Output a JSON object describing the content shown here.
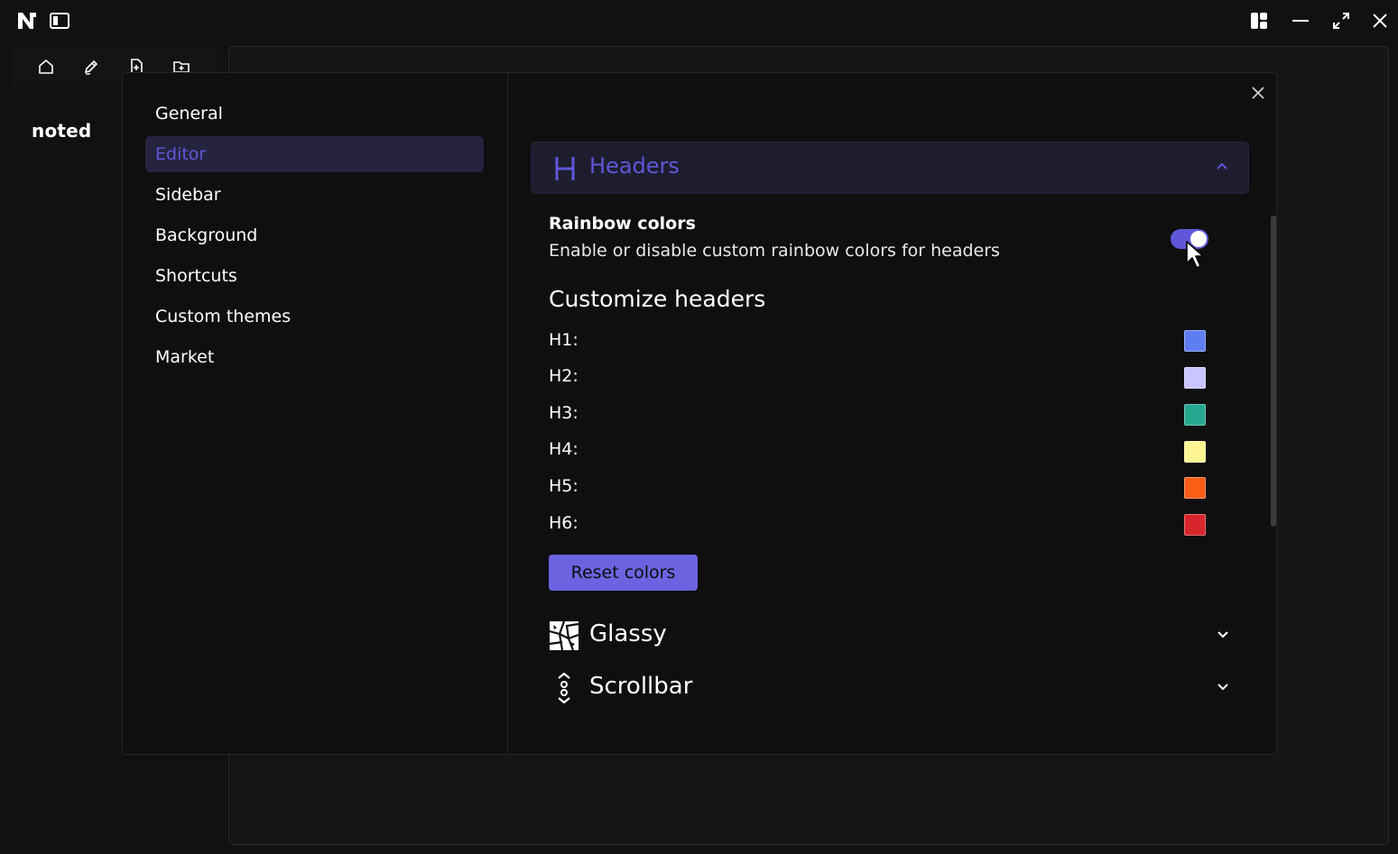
{
  "titlebar": {
    "logo_icon": "app-logo-icon",
    "sidebar_toggle_icon": "sidebar-toggle-icon",
    "window_controls": [
      "layout-icon",
      "minimize-icon",
      "maximize-icon",
      "close-icon"
    ]
  },
  "toolbar": {
    "icons": [
      "home-icon",
      "edit-pen-icon",
      "new-file-icon",
      "new-folder-icon"
    ]
  },
  "app": {
    "name": "noted"
  },
  "settings": {
    "nav": [
      "General",
      "Editor",
      "Sidebar",
      "Background",
      "Shortcuts",
      "Custom themes",
      "Market"
    ],
    "active_nav": "Editor",
    "headers_section": {
      "icon": "H",
      "title": "Headers",
      "expanded": true
    },
    "rainbow": {
      "title": "Rainbow colors",
      "description": "Enable or disable custom rainbow colors for headers",
      "enabled": true
    },
    "customize_title": "Customize headers",
    "header_colors": [
      {
        "label": "H1:",
        "color": "#5e7ef0"
      },
      {
        "label": "H2:",
        "color": "#c8c5ff"
      },
      {
        "label": "H3:",
        "color": "#25a88f"
      },
      {
        "label": "H4:",
        "color": "#fdf593"
      },
      {
        "label": "H5:",
        "color": "#f95e17"
      },
      {
        "label": "H6:",
        "color": "#d7262b"
      }
    ],
    "reset_label": "Reset colors",
    "glassy_section": {
      "icon": "glass-shatter-icon",
      "title": "Glassy",
      "expanded": false
    },
    "scrollbar_section": {
      "icon": "scrollbar-icon",
      "title": "Scrollbar",
      "expanded": false
    }
  },
  "colors": {
    "accent": "#5f57d8",
    "accent_bg": "#25233f",
    "background": "#111111"
  }
}
